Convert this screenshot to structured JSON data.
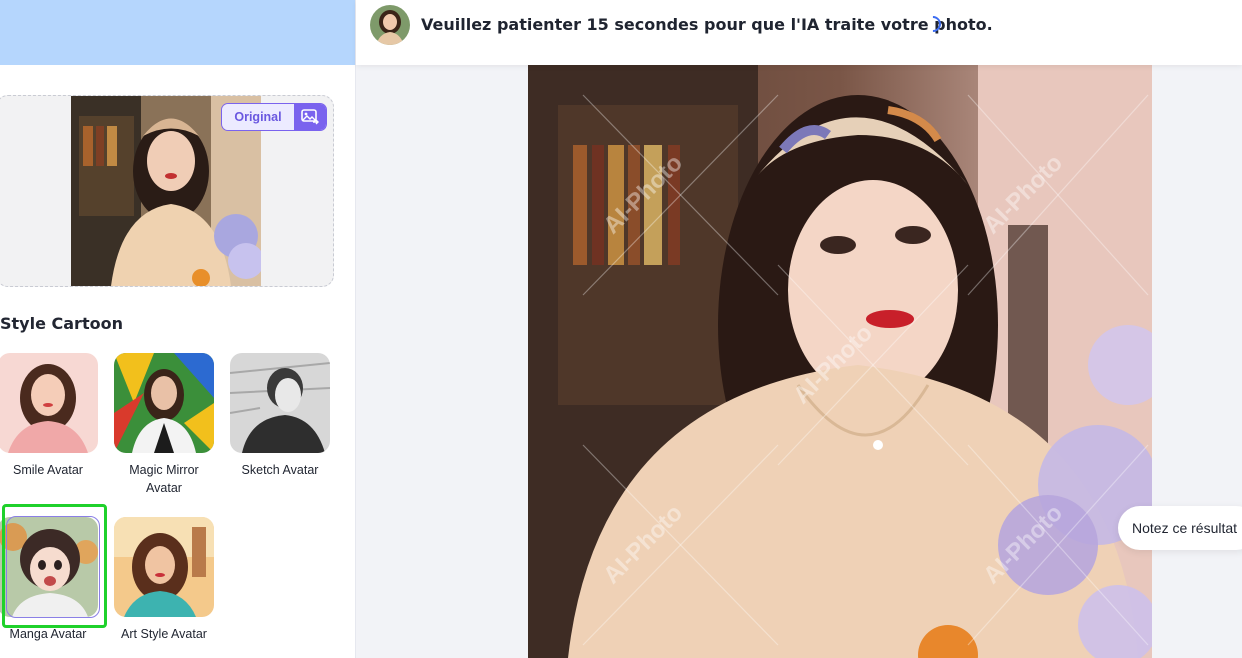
{
  "status": {
    "message": "Veuillez patienter 15 secondes pour que l'IA traite votre photo."
  },
  "upload": {
    "original_label": "Original",
    "compare_icon": "image-compare-icon"
  },
  "styles": {
    "title": "Style Cartoon",
    "items": [
      {
        "label": "Smile Avatar"
      },
      {
        "label": "Magic Mirror Avatar"
      },
      {
        "label": "Sketch Avatar"
      },
      {
        "label": "Manga Avatar",
        "selected": true
      },
      {
        "label": "Art Style Avatar"
      }
    ]
  },
  "result": {
    "watermark": "AI-Photo",
    "rate_label": "Notez ce résultat"
  },
  "colors": {
    "accent": "#7a63ee",
    "header_blue": "#b5d6fd",
    "selection_green": "#1fd12b",
    "spinner": "#3d6df2"
  }
}
